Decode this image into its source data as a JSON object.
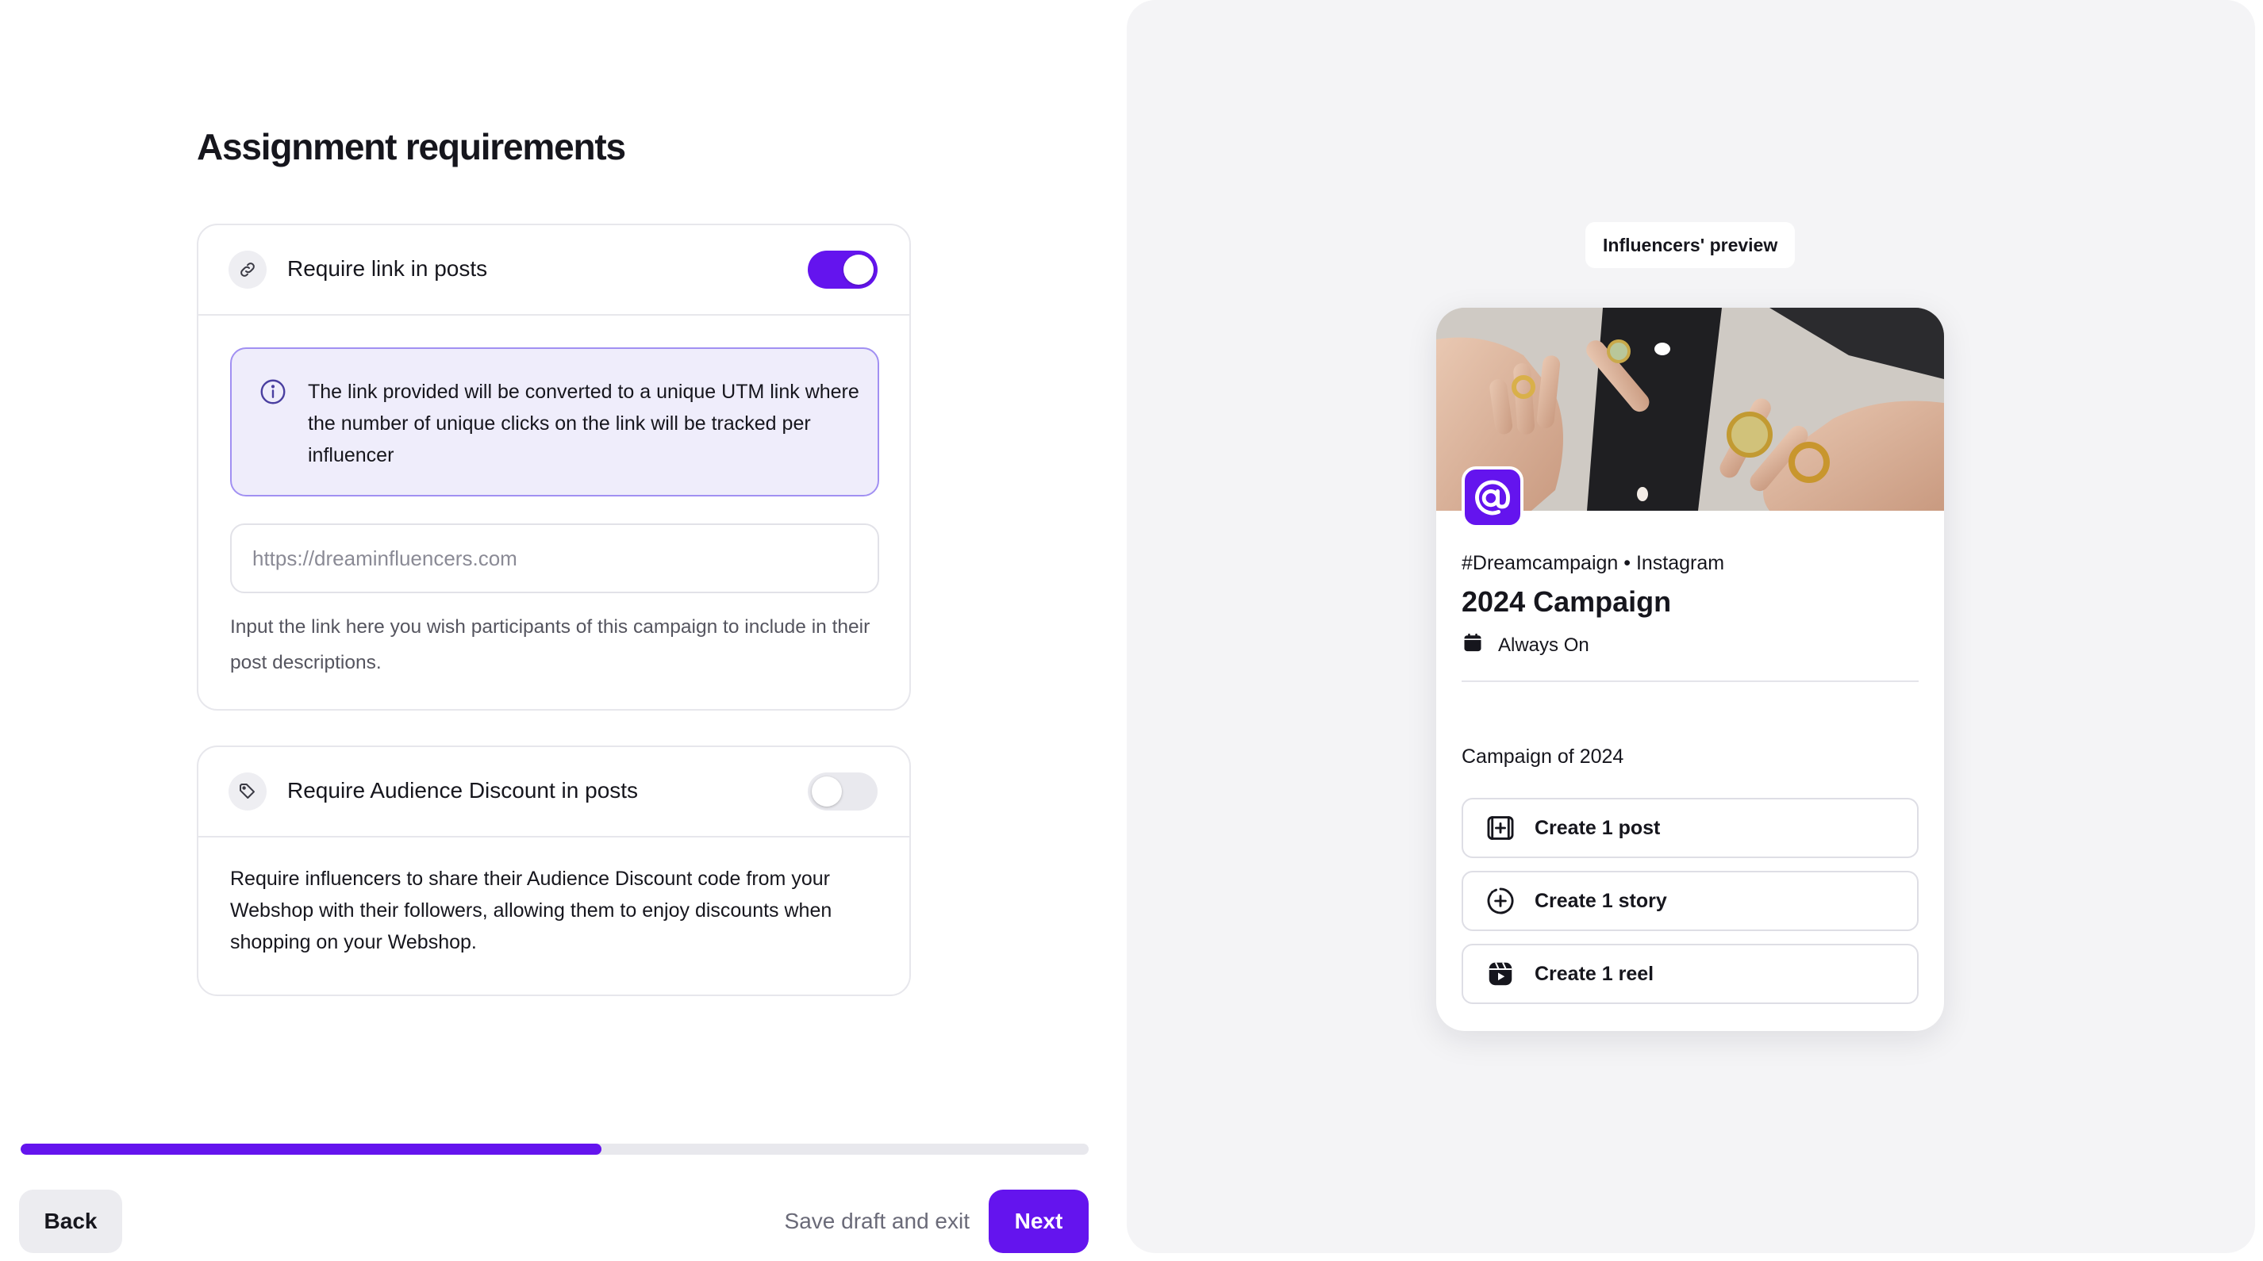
{
  "page": {
    "title": "Assignment requirements"
  },
  "link_requirement": {
    "label": "Require link in posts",
    "icon": "link-icon",
    "enabled": true,
    "info_icon": "info-icon",
    "info_text": "The link provided will be converted to a unique UTM link where the number of unique clicks on the link will be tracked per influencer",
    "url_placeholder": "https://dreaminfluencers.com",
    "url_value": "",
    "helper_text": "Input the link here you wish participants of this campaign to include in their post descriptions."
  },
  "discount_requirement": {
    "label": "Require Audience Discount in posts",
    "icon": "tag-icon",
    "enabled": false,
    "description": "Require influencers to share their Audience Discount code from your Webshop with their followers, allowing them to enjoy discounts when shopping on your Webshop."
  },
  "progress": {
    "fraction": 0.544
  },
  "footer": {
    "back_label": "Back",
    "save_label": "Save draft and exit",
    "next_label": "Next"
  },
  "preview": {
    "label": "Influencers' preview",
    "hashtag_platform": "#Dreamcampaign • Instagram",
    "campaign_title": "2024 Campaign",
    "schedule_icon": "calendar-icon",
    "schedule": "Always On",
    "description": "Campaign of 2024",
    "tasks": [
      {
        "icon": "post-plus-icon",
        "label": "Create 1 post"
      },
      {
        "icon": "story-plus-icon",
        "label": "Create 1 story"
      },
      {
        "icon": "reel-icon",
        "label": "Create 1 reel"
      }
    ]
  },
  "colors": {
    "accent": "#6414ee",
    "info_bg": "#efedfb",
    "info_border": "#a190f2",
    "panel_bg": "#f4f4f6"
  }
}
